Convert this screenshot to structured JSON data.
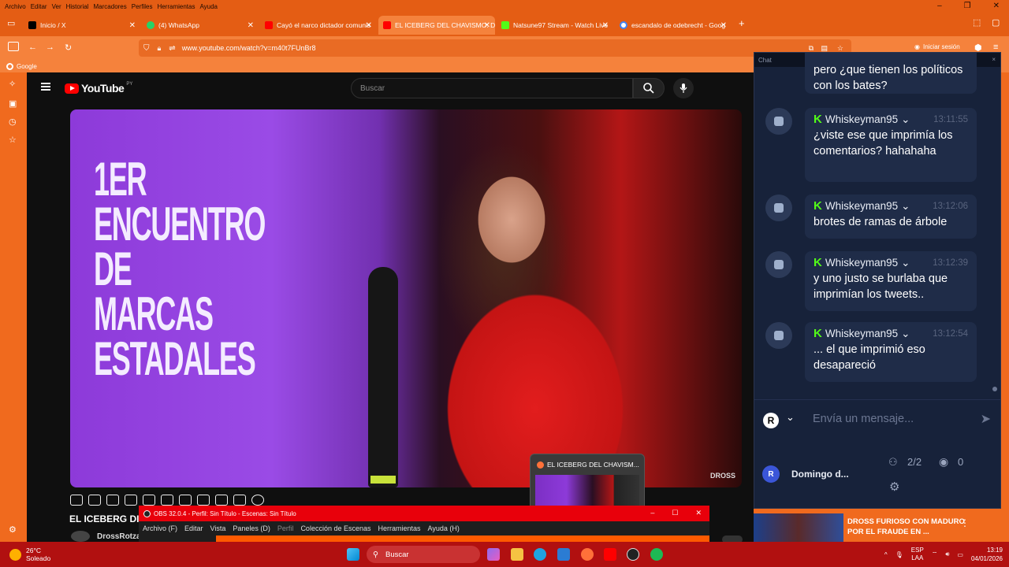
{
  "menubar": [
    "Archivo",
    "Editar",
    "Ver",
    "Historial",
    "Marcadores",
    "Perfiles",
    "Herramientas",
    "Ayuda"
  ],
  "window_controls": [
    "–",
    "❐",
    "✕"
  ],
  "tabs": [
    {
      "label": "Inicio / X",
      "icon": "x-logo-icon",
      "fav_color": "#000000"
    },
    {
      "label": "(4) WhatsApp",
      "icon": "whatsapp-icon",
      "fav_color": "#25d366"
    },
    {
      "label": "Cayó el narco dictador comunis",
      "icon": "youtube-icon",
      "fav_color": "#ff0000"
    },
    {
      "label": "EL ICEBERG DEL CHAVISMO: De",
      "icon": "youtube-icon",
      "fav_color": "#ff0000",
      "active": true
    },
    {
      "label": "Natsune97 Stream - Watch Live",
      "icon": "kick-icon",
      "fav_color": "#53fc18"
    },
    {
      "label": "escandalo de odebrecht - Goog",
      "icon": "google-icon",
      "fav_color": "#4285f4"
    }
  ],
  "address": {
    "url": "www.youtube.com/watch?v=m40t7FUnBr8",
    "signin": "Iniciar sesión"
  },
  "bookmarks": [
    "Google"
  ],
  "youtube": {
    "brand": "YouTube",
    "region": "PY",
    "search_placeholder": "Buscar",
    "video_banner": "1ER ENCUENTRO DE MARCAS ESTADALES",
    "watermark": "DROSS",
    "video_title": "EL ICEBERG DI",
    "channel": "DrossRotza"
  },
  "obs": {
    "title": "OBS 32.0.4 - Perfil: Sin Título - Escenas: Sin Título",
    "menu": [
      "Archivo (F)",
      "Editar",
      "Vista",
      "Paneles (D)",
      "Perfil",
      "Colección de Escenas",
      "Herramientas",
      "Ayuda (H)"
    ]
  },
  "thumbnail_preview": {
    "label": "EL ICEBERG DEL CHAVISM..."
  },
  "chat": {
    "header": "Chat",
    "partial_message": "pero ¿que tienen los políticos con los bates?",
    "messages": [
      {
        "user": "Whiskeyman95",
        "time": "13:11:55",
        "text": "¿viste ese que imprimía los comentarios? hahahaha"
      },
      {
        "user": "Whiskeyman95",
        "time": "13:12:06",
        "text": "brotes de ramas de árbole"
      },
      {
        "user": "Whiskeyman95",
        "time": "13:12:39",
        "text": "y uno justo se burlaba que imprimían los tweets.."
      },
      {
        "user": "Whiskeyman95",
        "time": "13:12:54",
        "text": "... el que imprimió eso desapareció"
      }
    ],
    "input_placeholder": "Envía un mensaje...",
    "footer": {
      "name": "Domingo d...",
      "count": "2/2",
      "viewers": "0"
    }
  },
  "recommended": {
    "title": "DROSS FURIOSO CON MADURO POR EL FRAUDE EN ..."
  },
  "taskbar": {
    "weather_temp": "26°C",
    "weather_desc": "Soleado",
    "search": "Buscar",
    "lang": "ESP",
    "lang2": "LAA",
    "time": "13:19",
    "date": "04/01/2026"
  }
}
